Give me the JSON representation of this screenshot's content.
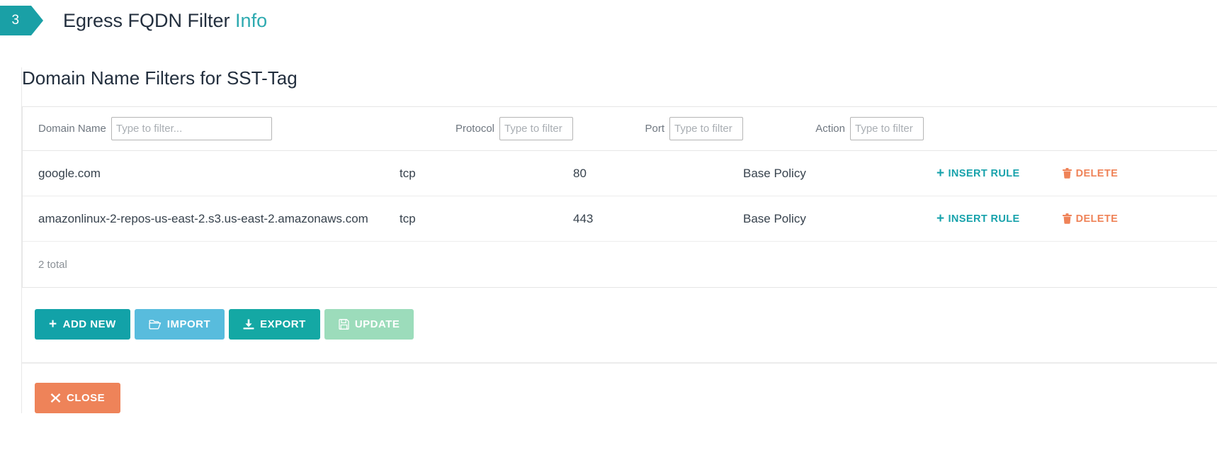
{
  "header": {
    "step_number": "3",
    "title": "Egress FQDN Filter",
    "info_label": "Info",
    "accent_color": "#1aa0a6"
  },
  "panel": {
    "title": "Domain Name Filters for SST-Tag"
  },
  "table": {
    "filters": [
      {
        "label": "Domain Name",
        "placeholder": "Type to filter...",
        "value": ""
      },
      {
        "label": "Protocol",
        "placeholder": "Type to filter",
        "value": ""
      },
      {
        "label": "Port",
        "placeholder": "Type to filter",
        "value": ""
      },
      {
        "label": "Action",
        "placeholder": "Type to filter",
        "value": ""
      }
    ],
    "rows": [
      {
        "domain": "google.com",
        "protocol": "tcp",
        "port": "80",
        "action": "Base Policy",
        "insert_label": "INSERT RULE",
        "delete_label": "DELETE"
      },
      {
        "domain": "amazonlinux-2-repos-us-east-2.s3.us-east-2.amazonaws.com",
        "protocol": "tcp",
        "port": "443",
        "action": "Base Policy",
        "insert_label": "INSERT RULE",
        "delete_label": "DELETE"
      }
    ],
    "total_label": "2 total",
    "insert_color": "#17a2ab",
    "delete_color": "#ef8358"
  },
  "actions": {
    "add_new": "ADD NEW",
    "import": "IMPORT",
    "export": "EXPORT",
    "update": "UPDATE",
    "close": "CLOSE"
  }
}
